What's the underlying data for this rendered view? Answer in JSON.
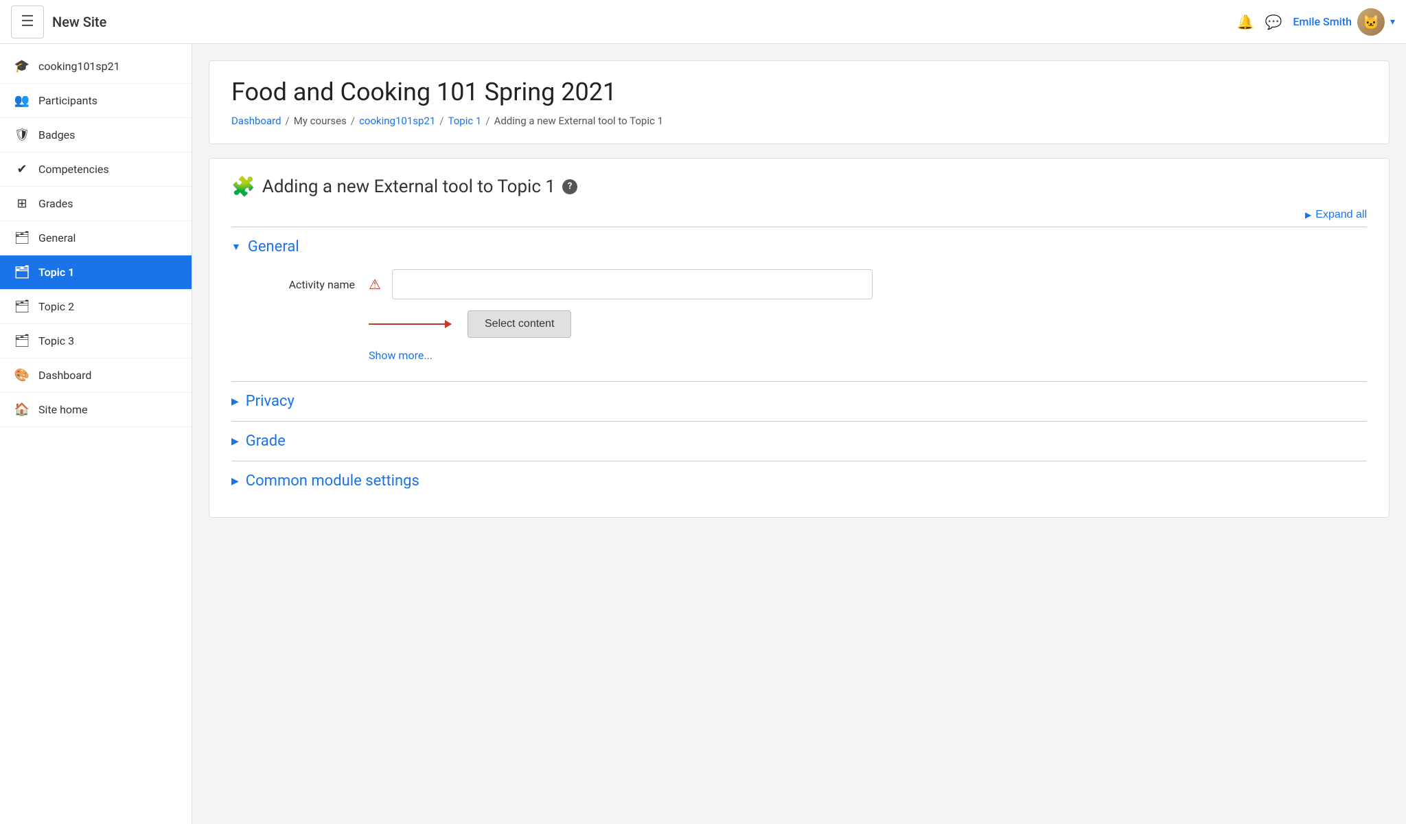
{
  "header": {
    "hamburger_label": "☰",
    "site_title": "New Site",
    "notifications_icon": "🔔",
    "messages_icon": "💬",
    "username": "Emile Smith",
    "dropdown_arrow": "▾"
  },
  "sidebar": {
    "items": [
      {
        "id": "cooking101sp21",
        "icon": "🎓",
        "label": "cooking101sp21",
        "active": false
      },
      {
        "id": "participants",
        "icon": "👥",
        "label": "Participants",
        "active": false
      },
      {
        "id": "badges",
        "icon": "🛡",
        "label": "Badges",
        "active": false
      },
      {
        "id": "competencies",
        "icon": "✔",
        "label": "Competencies",
        "active": false
      },
      {
        "id": "grades",
        "icon": "⊞",
        "label": "Grades",
        "active": false
      },
      {
        "id": "general",
        "icon": "🗂",
        "label": "General",
        "active": false
      },
      {
        "id": "topic1",
        "icon": "🗂",
        "label": "Topic 1",
        "active": true
      },
      {
        "id": "topic2",
        "icon": "🗂",
        "label": "Topic 2",
        "active": false
      },
      {
        "id": "topic3",
        "icon": "🗂",
        "label": "Topic 3",
        "active": false
      },
      {
        "id": "dashboard",
        "icon": "🎨",
        "label": "Dashboard",
        "active": false
      },
      {
        "id": "sitehome",
        "icon": "🏠",
        "label": "Site home",
        "active": false
      }
    ]
  },
  "breadcrumb_card": {
    "page_title": "Food and Cooking 101 Spring 2021",
    "breadcrumbs": [
      {
        "id": "dashboard",
        "label": "Dashboard",
        "link": true
      },
      {
        "id": "sep1",
        "label": "/",
        "link": false
      },
      {
        "id": "mycourses",
        "label": "My courses",
        "link": false
      },
      {
        "id": "sep2",
        "label": "/",
        "link": false
      },
      {
        "id": "cooking101sp21",
        "label": "cooking101sp21",
        "link": true
      },
      {
        "id": "sep3",
        "label": "/",
        "link": false
      },
      {
        "id": "topic1",
        "label": "Topic 1",
        "link": true
      },
      {
        "id": "sep4",
        "label": "/",
        "link": false
      },
      {
        "id": "current",
        "label": "Adding a new External tool to Topic 1",
        "link": false
      }
    ]
  },
  "form": {
    "title": "Adding a new External tool to Topic 1",
    "help_icon_label": "?",
    "expand_all_label": "Expand all",
    "sections": [
      {
        "id": "general",
        "title": "General",
        "expanded": true,
        "toggle": "▼"
      },
      {
        "id": "privacy",
        "title": "Privacy",
        "expanded": false,
        "toggle": "▶"
      },
      {
        "id": "grade",
        "title": "Grade",
        "expanded": false,
        "toggle": "▶"
      },
      {
        "id": "common-module",
        "title": "Common module settings",
        "expanded": false,
        "toggle": "▶"
      }
    ],
    "activity_name_label": "Activity name",
    "activity_name_placeholder": "",
    "select_content_label": "Select content",
    "show_more_label": "Show more..."
  }
}
